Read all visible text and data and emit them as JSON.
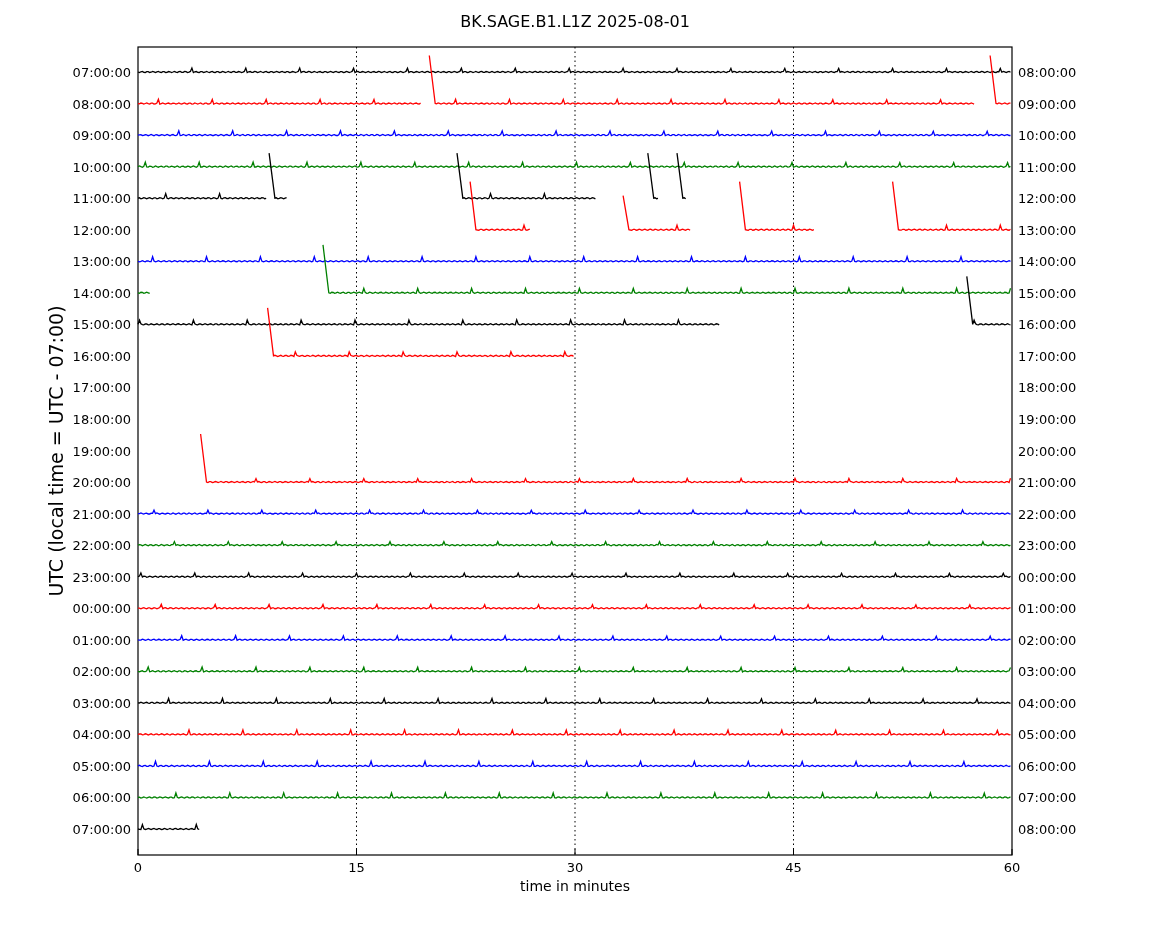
{
  "title": "BK.SAGE.B1.L1Z 2025-08-01",
  "ylabel": "UTC (local time = UTC - 07:00)",
  "xlabel": "time in minutes",
  "xticks": [
    "0",
    "15",
    "30",
    "45",
    "60"
  ],
  "rows": [
    {
      "left": "07:00:00",
      "right": "08:00:00",
      "color": "#000000"
    },
    {
      "left": "08:00:00",
      "right": "09:00:00",
      "color": "#ff0000"
    },
    {
      "left": "09:00:00",
      "right": "10:00:00",
      "color": "#0000ff"
    },
    {
      "left": "10:00:00",
      "right": "11:00:00",
      "color": "#008000"
    },
    {
      "left": "11:00:00",
      "right": "12:00:00",
      "color": "#000000"
    },
    {
      "left": "12:00:00",
      "right": "13:00:00",
      "color": "#ff0000"
    },
    {
      "left": "13:00:00",
      "right": "14:00:00",
      "color": "#0000ff"
    },
    {
      "left": "14:00:00",
      "right": "15:00:00",
      "color": "#008000"
    },
    {
      "left": "15:00:00",
      "right": "16:00:00",
      "color": "#000000"
    },
    {
      "left": "16:00:00",
      "right": "17:00:00",
      "color": "#ff0000"
    },
    {
      "left": "17:00:00",
      "right": "18:00:00"
    },
    {
      "left": "18:00:00",
      "right": "19:00:00"
    },
    {
      "left": "19:00:00",
      "right": "20:00:00"
    },
    {
      "left": "20:00:00",
      "right": "21:00:00",
      "color": "#ff0000"
    },
    {
      "left": "21:00:00",
      "right": "22:00:00",
      "color": "#0000ff"
    },
    {
      "left": "22:00:00",
      "right": "23:00:00",
      "color": "#008000"
    },
    {
      "left": "23:00:00",
      "right": "00:00:00",
      "color": "#000000"
    },
    {
      "left": "00:00:00",
      "right": "01:00:00",
      "color": "#ff0000"
    },
    {
      "left": "01:00:00",
      "right": "02:00:00",
      "color": "#0000ff"
    },
    {
      "left": "02:00:00",
      "right": "03:00:00",
      "color": "#008000"
    },
    {
      "left": "03:00:00",
      "right": "04:00:00",
      "color": "#000000"
    },
    {
      "left": "04:00:00",
      "right": "05:00:00",
      "color": "#ff0000"
    },
    {
      "left": "05:00:00",
      "right": "06:00:00",
      "color": "#0000ff"
    },
    {
      "left": "06:00:00",
      "right": "07:00:00",
      "color": "#008000"
    },
    {
      "left": "07:00:00",
      "right": "08:00:00",
      "color": "#000000"
    }
  ]
}
